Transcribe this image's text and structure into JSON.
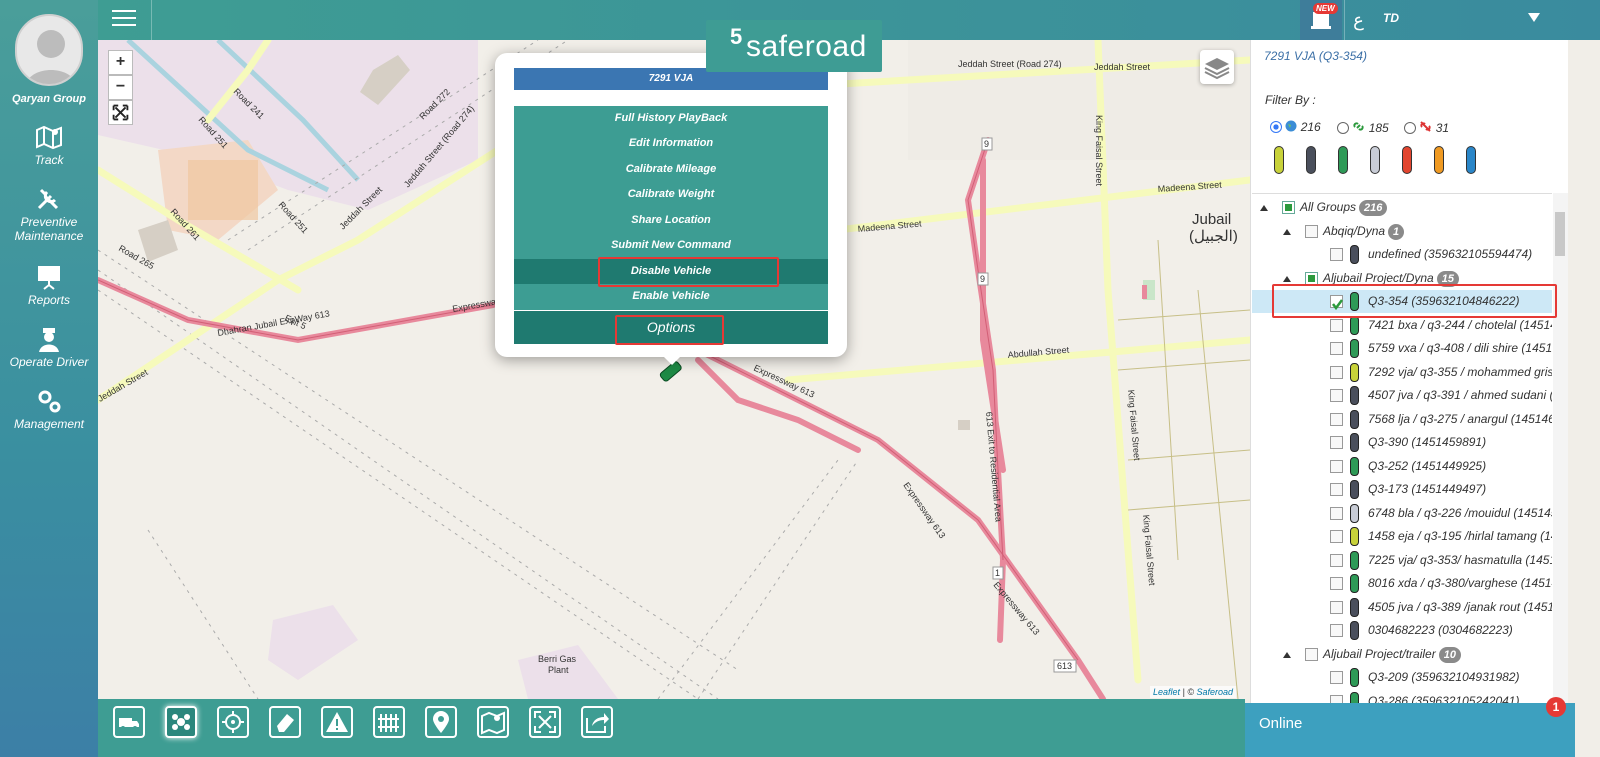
{
  "sidebar": {
    "org_name": "Qaryan Group",
    "items": [
      {
        "label": "Track",
        "icon": "map-icon"
      },
      {
        "label": "Preventive Maintenance",
        "icon": "tools-icon"
      },
      {
        "label": "Reports",
        "icon": "presentation-icon"
      },
      {
        "label": "Operate Driver",
        "icon": "driver-icon"
      },
      {
        "label": "Management",
        "icon": "gears-icon"
      }
    ]
  },
  "header": {
    "logo_text": "saferoad",
    "notif_badge": "NEW",
    "lang_label": "ع",
    "user_initials": "TD"
  },
  "map": {
    "attribution_leaflet": "Leaflet",
    "attribution_sep": " | © ",
    "attribution_owner": "Saferoad",
    "labels": {
      "road241": "Road 241",
      "road272": "Road 272",
      "road251a": "Road 251",
      "road251b": "Road 251",
      "jeddah274": "Jeddah Street (Road 274)",
      "jeddah_st_a": "Jeddah Street",
      "jeddah_st_b": "Jeddah Street",
      "road261": "Road 261",
      "road265": "Road 265",
      "jeddah_road274_top": "Jeddah Street (Road 274)",
      "jeddah_street_top": "Jeddah Street",
      "king_faisal_a": "King Faisal Street",
      "madeena_a": "Madeena Street",
      "madeena_b": "Madeena Street",
      "jubail": "Jubail",
      "jubail_ar": "(الجبيل)",
      "exit5": "Exit 5",
      "dhahran": "Dhahran Jubail ExpWay 613",
      "expressway_a": "Expressway",
      "expressway613_a": "Expressway 613",
      "abdullah": "Abdullah Street",
      "king_faisal_b": "King Faisal Street",
      "king_faisal_c": "King Faisal Street",
      "exit613": "613 Exit to Residential Area",
      "expressway613_b": "Expressway 613",
      "expressway613_c": "Expressway 613",
      "berri": "Berri Gas",
      "plant": "Plant",
      "shield9a": "9",
      "shield9b": "9",
      "shield1": "1",
      "shield613": "613",
      "jeddah_street_left": "Jeddah Street"
    }
  },
  "popup": {
    "title": "7291 VJA",
    "menu": [
      "Full History PlayBack",
      "Edit Information",
      "Calibrate Mileage",
      "Calibrate Weight",
      "Share Location",
      "Submit New Command",
      "Disable Vehicle",
      "Enable Vehicle"
    ],
    "options_label": "Options"
  },
  "right_panel": {
    "heading": "7291 VJA  (Q3-354)",
    "filter_label": "Filter By :",
    "filters": [
      {
        "count": "216",
        "icon": "globe-icon",
        "selected": true
      },
      {
        "count": "185",
        "icon": "link-icon",
        "selected": false
      },
      {
        "count": "31",
        "icon": "unlink-icon",
        "selected": false
      }
    ],
    "car_colors": [
      "#c8d23a",
      "#4a4f5c",
      "#2e9a57",
      "#c8ccd6",
      "#e2452f",
      "#f09a22",
      "#2a86c8"
    ],
    "tree": [
      {
        "label": "All Groups",
        "badge": "216",
        "level": 0,
        "type": "group",
        "check": "partial"
      },
      {
        "label": "Abqiq/Dyna",
        "badge": "1",
        "level": 1,
        "type": "group",
        "check": "none"
      },
      {
        "label": "undefined (359632105594474)",
        "level": 2,
        "type": "vehicle",
        "check": "none",
        "color": "#4a4f5c"
      },
      {
        "label": "Aljubail Project/Dyna",
        "badge": "15",
        "level": 1,
        "type": "group",
        "check": "partial"
      },
      {
        "label": "Q3-354 (359632104846222)",
        "level": 2,
        "type": "vehicle",
        "check": "checked",
        "color": "#2e9a57",
        "selected": true
      },
      {
        "label": "7421 bxa / q3-244 / chotelal (14514",
        "level": 2,
        "type": "vehicle",
        "check": "none",
        "color": "#2e9a57"
      },
      {
        "label": "5759 vxa / q3-408 / dili shire (14514",
        "level": 2,
        "type": "vehicle",
        "check": "none",
        "color": "#2e9a57"
      },
      {
        "label": "7292 vja/ q3-355 / mohammed gris",
        "level": 2,
        "type": "vehicle",
        "check": "none",
        "color": "#c8d23a"
      },
      {
        "label": "4507 jva / q3-391 / ahmed sudani (",
        "level": 2,
        "type": "vehicle",
        "check": "none",
        "color": "#4a4f5c"
      },
      {
        "label": "7568 lja / q3-275 / anargul (145146",
        "level": 2,
        "type": "vehicle",
        "check": "none",
        "color": "#4a4f5c"
      },
      {
        "label": "Q3-390 (1451459891)",
        "level": 2,
        "type": "vehicle",
        "check": "none",
        "color": "#4a4f5c"
      },
      {
        "label": " Q3-252 (1451449925)",
        "level": 2,
        "type": "vehicle",
        "check": "none",
        "color": "#2e9a57"
      },
      {
        "label": "Q3-173 (1451449497)",
        "level": 2,
        "type": "vehicle",
        "check": "none",
        "color": "#4a4f5c"
      },
      {
        "label": "6748 bla / q3-226 /mouidul (145145",
        "level": 2,
        "type": "vehicle",
        "check": "none",
        "color": "#c8ccd6"
      },
      {
        "label": "1458 eja / q3-195 /hirlal tamang (14",
        "level": 2,
        "type": "vehicle",
        "check": "none",
        "color": "#c8d23a"
      },
      {
        "label": "7225 vja/ q3-353/ hasmatulla (1451",
        "level": 2,
        "type": "vehicle",
        "check": "none",
        "color": "#2e9a57"
      },
      {
        "label": "8016 xda / q3-380/varghese (14514",
        "level": 2,
        "type": "vehicle",
        "check": "none",
        "color": "#2e9a57"
      },
      {
        "label": "4505 jva / q3-389 /janak rout (1451",
        "level": 2,
        "type": "vehicle",
        "check": "none",
        "color": "#4a4f5c"
      },
      {
        "label": "0304682223 (0304682223)",
        "level": 2,
        "type": "vehicle",
        "check": "none",
        "color": "#4a4f5c"
      },
      {
        "label": "Aljubail Project/trailer",
        "badge": "10",
        "level": 1,
        "type": "group",
        "check": "none"
      },
      {
        "label": "Q3-209 (359632104931982)",
        "level": 2,
        "type": "vehicle",
        "check": "none",
        "color": "#2e9a57"
      },
      {
        "label": "Q3-286 (359632105242041)",
        "level": 2,
        "type": "vehicle",
        "check": "none",
        "color": "#2e9a57"
      }
    ]
  },
  "bottom_toolbar": [
    "truck-icon",
    "cluster-icon",
    "locate-icon",
    "eraser-icon",
    "warning-icon",
    "fence-icon",
    "pin-icon",
    "route-map-icon",
    "fullscreen-icon",
    "share-icon"
  ],
  "status": {
    "online_label": "Online",
    "online_count": "1"
  }
}
